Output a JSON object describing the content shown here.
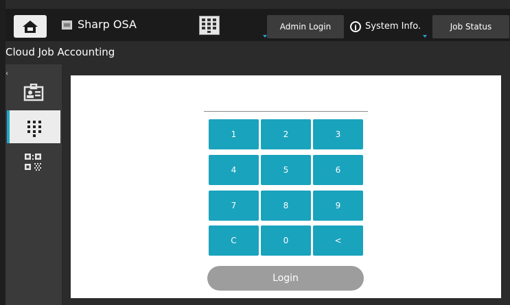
{
  "topbar": {
    "app_title": "Sharp OSA",
    "admin_login_label": "Admin Login",
    "system_info_label": "System Info.",
    "job_status_label": "Job Status"
  },
  "section": {
    "title": "Cloud Job Accounting"
  },
  "sidebar": {
    "items": [
      {
        "icon": "id-card-icon",
        "active": false
      },
      {
        "icon": "keypad-icon",
        "active": true
      },
      {
        "icon": "qr-code-icon",
        "active": false
      }
    ]
  },
  "keypad": {
    "keys": [
      "1",
      "2",
      "3",
      "4",
      "5",
      "6",
      "7",
      "8",
      "9",
      "C",
      "0",
      "<"
    ]
  },
  "login": {
    "label": "Login"
  },
  "colors": {
    "accent": "#1aa3bd",
    "active_indicator": "#22a6c8",
    "login_disabled": "#9d9d9d"
  }
}
